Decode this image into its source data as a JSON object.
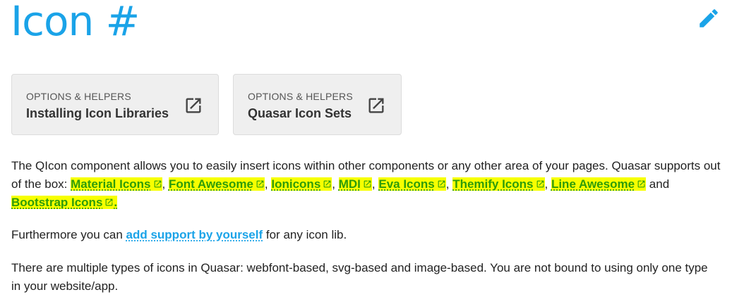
{
  "page": {
    "title": "Icon #"
  },
  "cards": [
    {
      "caption": "OPTIONS & HELPERS",
      "name": "Installing Icon Libraries"
    },
    {
      "caption": "OPTIONS & HELPERS",
      "name": "Quasar Icon Sets"
    }
  ],
  "intro": {
    "text_before": "The QIcon component allows you to easily insert icons within other components or any other area of your pages. Quasar supports out of the box: ",
    "libs": [
      "Material Icons",
      "Font Awesome",
      "Ionicons",
      "MDI",
      "Eva Icons",
      "Themify Icons",
      "Line Awesome",
      "Bootstrap Icons"
    ],
    "sep_comma": ", ",
    "sep_and": " and ",
    "end": "."
  },
  "support": {
    "before": "Furthermore you can ",
    "link": "add support by yourself",
    "after": " for any icon lib."
  },
  "types": {
    "text": "There are multiple types of icons in Quasar: webfont-based, svg-based and image-based. You are not bound to using only one type in your website/app."
  },
  "colors": {
    "accent": "#1aa3e8",
    "highlight": "#f7ff00",
    "highlight_text": "#2e9c0a"
  },
  "icons": {
    "edit": "pencil-icon",
    "external": "open-in-new-icon"
  }
}
